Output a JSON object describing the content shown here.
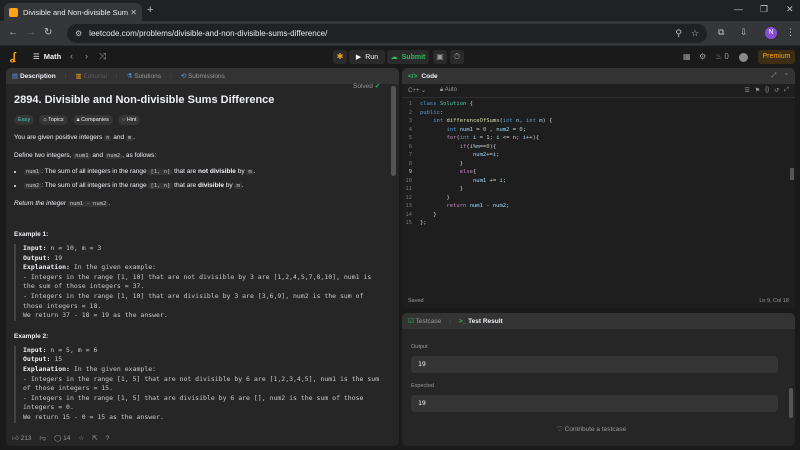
{
  "browser": {
    "tab_title": "Divisible and Non-divisible Sum",
    "url": "leetcode.com/problems/divisible-and-non-divisible-sums-difference/",
    "profile_initial": "N"
  },
  "topbar": {
    "problem_list": "Math",
    "run": "Run",
    "submit": "Submit",
    "streak": "0",
    "premium": "Premium"
  },
  "left_tabs": [
    "Description",
    "Editorial",
    "Solutions",
    "Submissions"
  ],
  "problem": {
    "title": "2894. Divisible and Non-divisible Sums Difference",
    "status": "Solved",
    "tags": [
      "Easy",
      "Topics",
      "Companies",
      "Hint"
    ],
    "intro_a": "You are given positive integers ",
    "intro_n": "n",
    "intro_and": " and ",
    "intro_m": "m",
    "intro_end": ".",
    "define_a": "Define two integers, ",
    "define_num1": "num1",
    "define_and": " and ",
    "define_num2": "num2",
    "define_end": ", as follows:",
    "b1_code": "num1",
    "b1_text": ": The sum of all integers in the range ",
    "b1_range": "[1, n]",
    "b1_that": " that are ",
    "b1_bold": "not divisible",
    "b1_by": " by ",
    "b1_m": "m",
    "b1_end": ".",
    "b2_code": "num2",
    "b2_text": ": The sum of all integers in the range ",
    "b2_range": "[1, n]",
    "b2_that": " that are ",
    "b2_bold": "divisible",
    "b2_by": " by ",
    "b2_m": "m",
    "b2_end": ".",
    "return_a": "Return ",
    "return_em": "the integer",
    "return_code": "num1 - num2",
    "return_end": ".",
    "ex1_heading": "Example 1:",
    "ex1_input_k": "Input:",
    "ex1_input_v": " n = 10, m = 3",
    "ex1_output_k": "Output:",
    "ex1_output_v": " 19",
    "ex1_expl_k": "Explanation:",
    "ex1_expl_v": " In the given example:",
    "ex1_l1": "- Integers in the range [1, 10] that are not divisible by 3 are [1,2,4,5,7,8,10], num1 is",
    "ex1_l2": "the sum of those integers = 37.",
    "ex1_l3": "- Integers in the range [1, 10] that are divisible by 3 are [3,6,9], num2 is the sum of",
    "ex1_l4": "those integers = 18.",
    "ex1_l5": "We return 37 - 18 = 19 as the answer.",
    "ex2_heading": "Example 2:",
    "ex2_input_k": "Input:",
    "ex2_input_v": " n = 5, m = 6",
    "ex2_output_k": "Output:",
    "ex2_output_v": " 15",
    "ex2_expl_k": "Explanation:",
    "ex2_expl_v": " In the given example:",
    "ex2_l1": "- Integers in the range [1, 5] that are not divisible by 6 are [1,2,3,4,5], num1 is the sum",
    "ex2_l2": "of those integers = 15.",
    "ex2_l3": "- Integers in the range [1, 5] that are divisible by 6 are [], num2 is the sum of those",
    "ex2_l4": "integers = 0.",
    "ex2_l5": "We return 15 - 0 = 15 as the answer."
  },
  "left_footer": {
    "likes": "213",
    "comments": "14"
  },
  "code_panel": {
    "title": "Code",
    "language": "C++",
    "mode": "Auto",
    "status": "Saved",
    "cursor": "Ln 9, Col 18"
  },
  "result_panel": {
    "tab_testcase": "Testcase",
    "tab_result": "Test Result",
    "output_label": "Output",
    "output_value": "19",
    "expected_label": "Expected",
    "expected_value": "19",
    "contribute": "Contribute a testcase"
  },
  "colors": {
    "accent": "#ffa116",
    "success": "#2cbb5d",
    "easy": "#46c6c2"
  }
}
